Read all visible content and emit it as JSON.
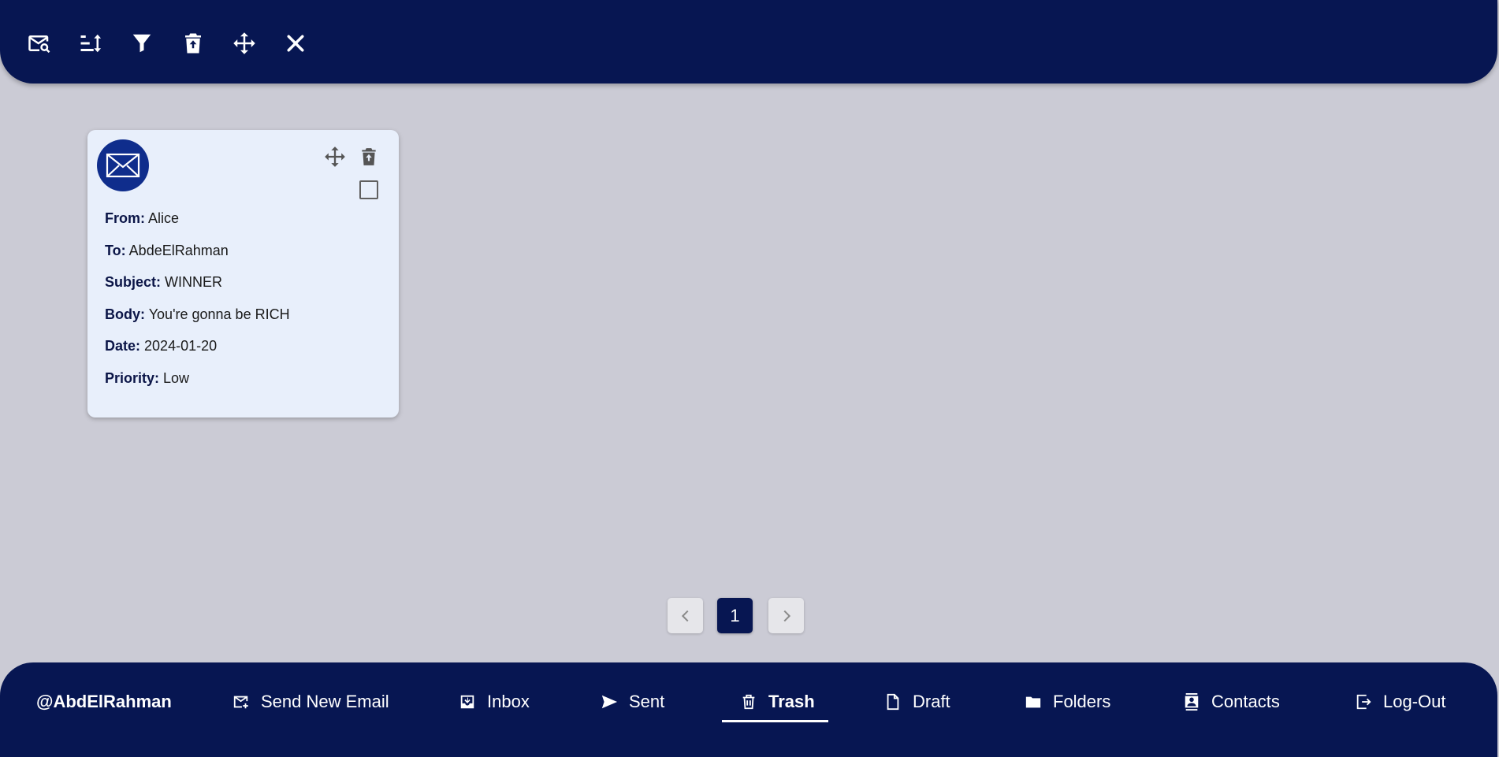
{
  "toolbar": {
    "icons": [
      "search-mail-icon",
      "sort-icon",
      "filter-icon",
      "delete-icon",
      "move-icon",
      "close-icon"
    ],
    "background": "#071652"
  },
  "email_card": {
    "avatar_icon": "envelope-icon",
    "fields": [
      {
        "label": "From:",
        "value": "Alice"
      },
      {
        "label": "To:",
        "value": "AbdeElRahman"
      },
      {
        "label": "Subject:",
        "value": "WINNER"
      },
      {
        "label": "Body:",
        "value": "You're gonna be RICH"
      },
      {
        "label": "Date:",
        "value": "2024-01-20"
      },
      {
        "label": "Priority:",
        "value": "Low"
      }
    ],
    "selected": false
  },
  "pagination": {
    "prev_icon": "chevron-left-icon",
    "current_page": "1",
    "next_icon": "chevron-right-icon"
  },
  "nav": {
    "username": "@AbdElRahman",
    "items": [
      {
        "label": "Send New Email",
        "icon": "compose-mail-icon"
      },
      {
        "label": "Inbox",
        "icon": "inbox-icon"
      },
      {
        "label": "Sent",
        "icon": "send-icon"
      },
      {
        "label": "Trash",
        "icon": "trash-icon"
      },
      {
        "label": "Draft",
        "icon": "file-icon"
      },
      {
        "label": "Folders",
        "icon": "folder-icon"
      },
      {
        "label": "Contacts",
        "icon": "contacts-icon"
      },
      {
        "label": "Log-Out",
        "icon": "logout-icon"
      }
    ],
    "active_item": "Trash"
  },
  "colors": {
    "accent": "#071652",
    "page_background": "#cbcbd5",
    "card_background": "#e8effb",
    "avatar": "#0f2d8c"
  }
}
